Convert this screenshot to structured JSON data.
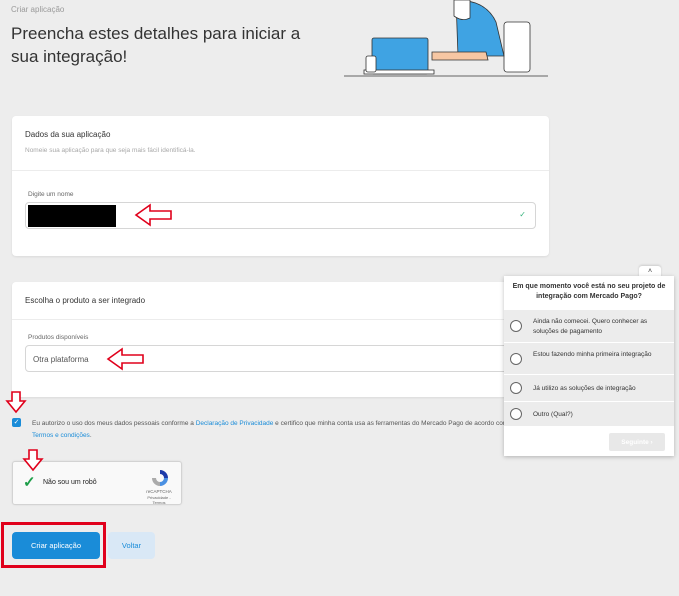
{
  "breadcrumb": "Criar aplicação",
  "page_title": "Preencha estes detalhes para iniciar a sua integração!",
  "card_app": {
    "title": "Dados da sua aplicação",
    "subtitle": "Nomeie sua aplicação para que seja mais fácil identificá-la.",
    "field_label": "Digite um nome",
    "field_value": ""
  },
  "card_product": {
    "title": "Escolha o produto a ser integrado",
    "field_label": "Produtos disponíveis",
    "field_value": "Otra plataforma"
  },
  "consent": {
    "text_before": "Eu autorizo o uso dos meus dados pessoais conforme a ",
    "privacy_link": "Declaração de Privacidade",
    "text_middle": " e certifico que minha conta usa as ferramentas do Mercado Pago de acordo com os ",
    "terms_link": "Termos e condições",
    "text_after": ".",
    "checked": true
  },
  "recaptcha": {
    "label": "Não sou um robô",
    "brand": "reCAPTCHA",
    "terms": "Privacidade - Termos"
  },
  "buttons": {
    "create": "Criar aplicação",
    "back": "Voltar"
  },
  "survey": {
    "question": "Em que momento você está no seu projeto de integração com Mercado Pago?",
    "options": [
      "Ainda não comecei. Quero conhecer as soluções de pagamento",
      "Estou fazendo minha primeira integração",
      "Já utilizo as soluções de integração",
      "Outro (Qual?)"
    ],
    "next": "Seguinte"
  },
  "colors": {
    "accent": "#1a8cd8",
    "annotation": "#e0001b"
  }
}
